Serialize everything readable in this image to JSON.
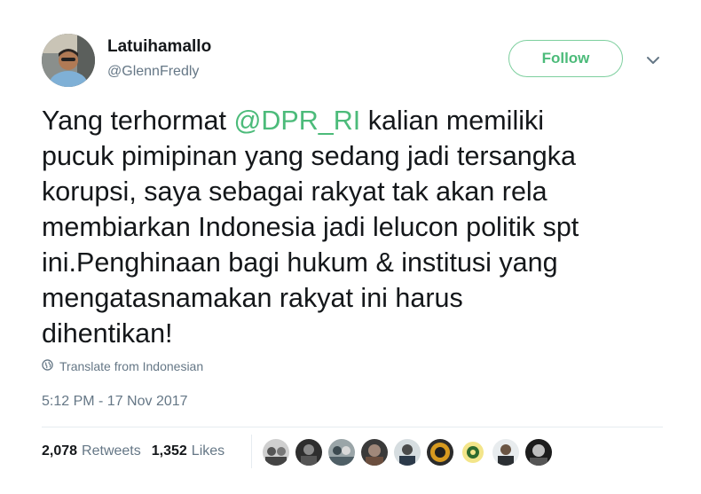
{
  "author": {
    "display_name": "Latuihamallo",
    "handle": "@GlennFredly"
  },
  "follow_label": "Follow",
  "tweet": {
    "text_before": "Yang terhormat ",
    "mention": "@DPR_RI",
    "text_after": " kalian memiliki\npucuk pimipinan yang sedang jadi tersangka\nkorupsi, saya sebagai rakyat tak akan rela\nmembiarkan Indonesia jadi lelucon politik spt\nini.Penghinaan bagi hukum & institusi yang\nmengatasnamakan rakyat ini harus\ndihentikan!"
  },
  "translate_label": "Translate from Indonesian",
  "timestamp": "5:12 PM - 17 Nov 2017",
  "stats": {
    "retweets_count": "2,078",
    "retweets_label": "Retweets",
    "likes_count": "1,352",
    "likes_label": "Likes"
  },
  "colors": {
    "accent": "#4cbb7a",
    "secondary_text": "#657786",
    "divider": "#e6ecf0"
  },
  "icons": {
    "more": "chevron-down-icon",
    "translate": "globe-icon"
  }
}
